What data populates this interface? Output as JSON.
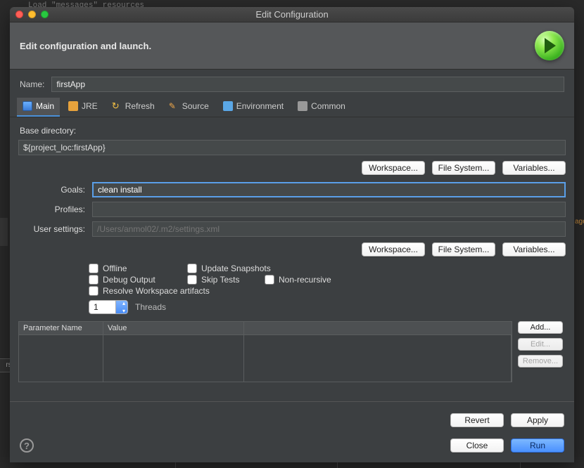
{
  "bg": {
    "fragment": "Load \"messages\" resources"
  },
  "dialog": {
    "title": "Edit Configuration",
    "header": "Edit configuration and launch."
  },
  "form": {
    "name_label": "Name:",
    "name_value": "firstApp",
    "base_dir_label": "Base directory:",
    "base_dir_value": "${project_loc:firstApp}",
    "goals_label": "Goals:",
    "goals_value": "clean install",
    "profiles_label": "Profiles:",
    "profiles_value": "",
    "usersettings_label": "User settings:",
    "usersettings_placeholder": "/Users/anmol02/.m2/settings.xml",
    "threads_label": "Threads",
    "threads_value": "1"
  },
  "tabs": {
    "main": "Main",
    "jre": "JRE",
    "refresh": "Refresh",
    "source": "Source",
    "environment": "Environment",
    "common": "Common"
  },
  "buttons": {
    "workspace": "Workspace...",
    "filesystem": "File System...",
    "variables": "Variables...",
    "add": "Add...",
    "edit": "Edit...",
    "remove": "Remove...",
    "revert": "Revert",
    "apply": "Apply",
    "close": "Close",
    "run": "Run"
  },
  "checks": {
    "offline": "Offline",
    "update_snapshots": "Update Snapshots",
    "debug_output": "Debug Output",
    "skip_tests": "Skip Tests",
    "non_recursive": "Non-recursive",
    "resolve_ws": "Resolve Workspace artifacts"
  },
  "table": {
    "col_param": "Parameter Name",
    "col_value": "Value"
  }
}
